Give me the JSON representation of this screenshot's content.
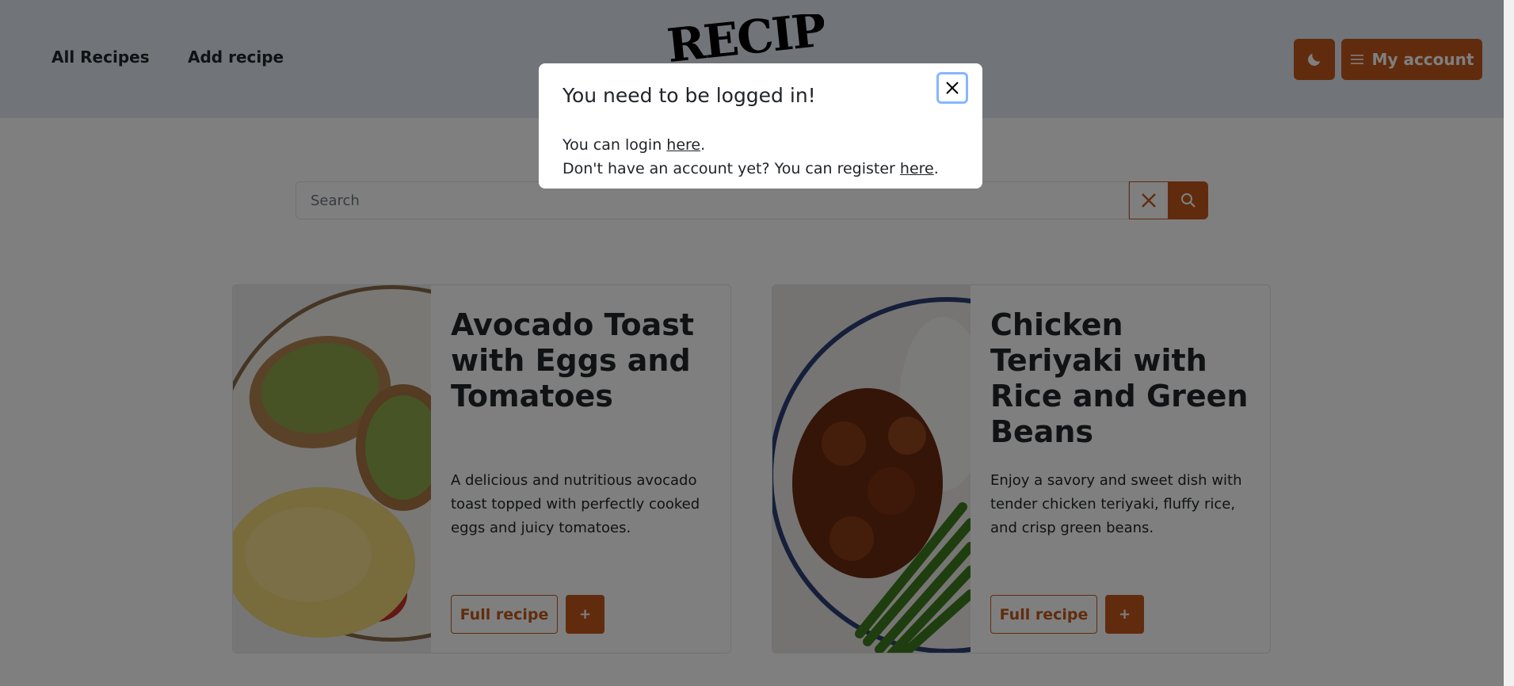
{
  "nav": {
    "all_recipes": "All Recipes",
    "add_recipe": "Add recipe",
    "logo_text": "RECIPE",
    "theme_icon": "moon-icon",
    "account_icon": "hamburger-menu-icon",
    "account_label": "My account"
  },
  "search": {
    "placeholder": "Search",
    "clear_icon": "close-icon",
    "search_icon": "search-icon"
  },
  "recipes": [
    {
      "title": "Avocado Toast with Eggs and Tomatoes",
      "description": "A delicious and nutritious avocado toast topped with perfectly cooked eggs and juicy tomatoes.",
      "full_recipe_label": "Full recipe",
      "add_label": "+"
    },
    {
      "title": "Chicken Teriyaki with Rice and Green Beans",
      "description": "Enjoy a savory and sweet dish with tender chicken teriyaki, fluffy rice, and crisp green beans.",
      "full_recipe_label": "Full recipe",
      "add_label": "+"
    }
  ],
  "modal": {
    "title": "You need to be logged in!",
    "login_prefix": "You can login ",
    "login_link": "here",
    "login_suffix": ".",
    "register_prefix": "Don't have an account yet? You can register ",
    "register_link": "here",
    "register_suffix": ".",
    "close_icon": "close-icon"
  },
  "colors": {
    "accent": "#c2591d",
    "header_bg": "#e2e8f0"
  }
}
